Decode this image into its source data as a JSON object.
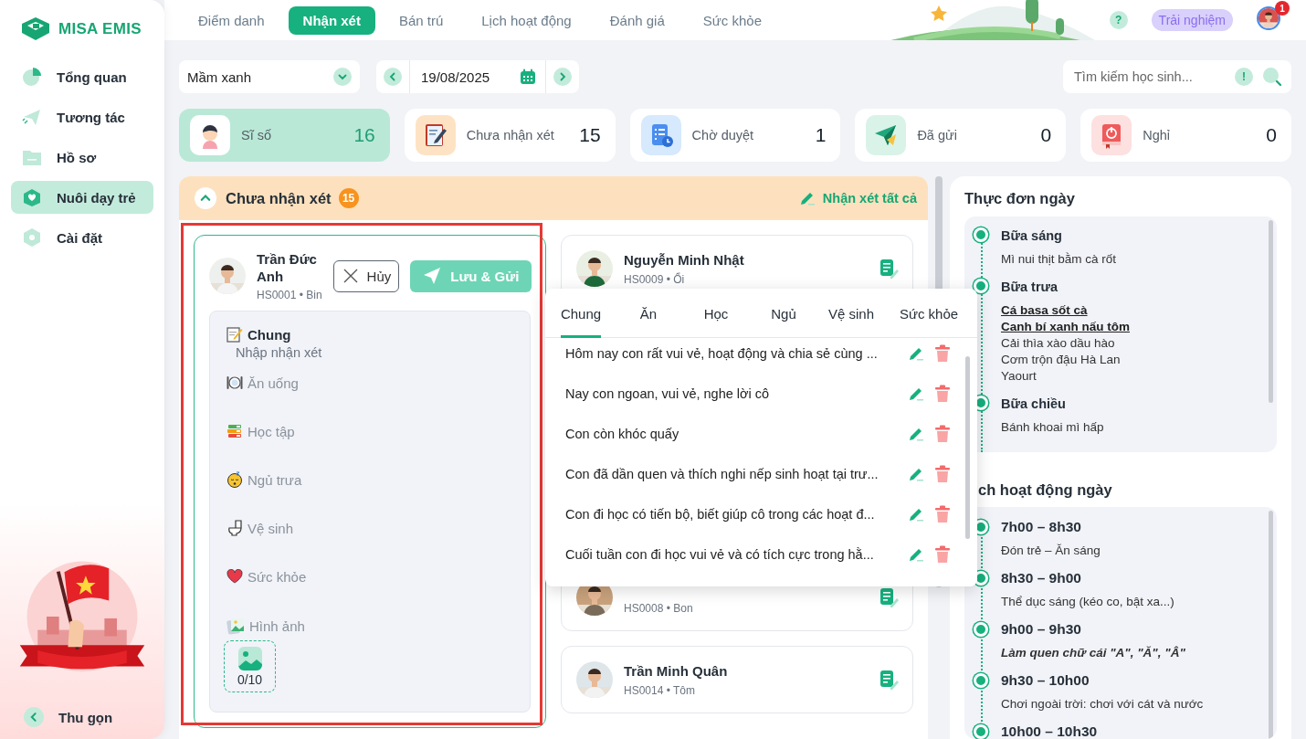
{
  "sidebar": {
    "logo": "MISA EMIS",
    "items": [
      {
        "label": "Tổng quan",
        "selected": false
      },
      {
        "label": "Tương tác",
        "selected": false
      },
      {
        "label": "Hồ sơ",
        "selected": false
      },
      {
        "label": "Nuôi dạy trẻ",
        "selected": true
      },
      {
        "label": "Cài đặt",
        "selected": false
      }
    ],
    "collapse": "Thu gọn"
  },
  "topbar": {
    "tabs": [
      {
        "label": "Điểm danh",
        "selected": false
      },
      {
        "label": "Nhận xét",
        "selected": true
      },
      {
        "label": "Bán trú",
        "selected": false
      },
      {
        "label": "Lịch hoạt động",
        "selected": false
      },
      {
        "label": "Đánh giá",
        "selected": false
      },
      {
        "label": "Sức khỏe",
        "selected": false
      }
    ],
    "help": "?",
    "trial": "Trải nghiệm",
    "notifications": "1"
  },
  "toolbar": {
    "class_select": "Mầm xanh",
    "date": "19/08/2025",
    "search": {
      "placeholder": "Tìm kiếm học sinh..."
    },
    "info": "!"
  },
  "stats": [
    {
      "label": "Sĩ số",
      "value": "16",
      "selected": true,
      "color": "#ffffff"
    },
    {
      "label": "Chưa nhận xét",
      "value": "15",
      "selected": false,
      "color": "#fde3c4"
    },
    {
      "label": "Chờ duyệt",
      "value": "1",
      "selected": false,
      "color": "#d6e9fd"
    },
    {
      "label": "Đã gửi",
      "value": "0",
      "selected": false,
      "color": "#d9f3e8"
    },
    {
      "label": "Nghỉ",
      "value": "0",
      "selected": false,
      "color": "#fde0e0"
    }
  ],
  "review": {
    "title": "Chưa nhận xét",
    "count": "15",
    "expanded": true,
    "action": "Nhận xét tất cả",
    "editor": {
      "name": "Trần Đức Anh",
      "code": "HS0001 • Bin",
      "focused": true,
      "cancel": "Hủy",
      "save": "Lưu & Gửi",
      "sections": [
        {
          "kind": "general",
          "label": "Chung",
          "active": true,
          "placeholder": "Nhập nhận xét"
        },
        {
          "kind": "meal",
          "label": "Ăn uống",
          "active": false
        },
        {
          "kind": "study",
          "label": "Học tập",
          "active": false
        },
        {
          "kind": "sleep",
          "label": "Ngủ trưa",
          "active": false
        },
        {
          "kind": "hygiene",
          "label": "Vệ sinh",
          "active": false
        },
        {
          "kind": "health",
          "label": "Sức khỏe",
          "active": false
        }
      ],
      "photos": {
        "label": "Hình ảnh",
        "count": "0/10"
      }
    },
    "students": [
      {
        "name": "Nguyễn Minh Nhật",
        "code": "HS0009 • Ổi"
      },
      {
        "code": "HS0008 • Bon"
      },
      {
        "name": "Trần Minh Quân",
        "code": "HS0014 • Tôm"
      }
    ]
  },
  "popup": {
    "tabs": [
      {
        "label": "Chung",
        "selected": true
      },
      {
        "label": "Ăn",
        "selected": false
      },
      {
        "label": "Học",
        "selected": false
      },
      {
        "label": "Ngủ",
        "selected": false
      },
      {
        "label": "Vệ sinh",
        "selected": false
      },
      {
        "label": "Sức khỏe",
        "selected": false
      }
    ],
    "comments": [
      "Hôm nay con rất vui vẻ, hoạt động và chia sẻ cùng ...",
      "Nay con ngoan, vui vẻ, nghe lời cô",
      "Con còn khóc quấy",
      "Con đã dần quen và thích nghi nếp sinh hoạt tại trư...",
      "Con đi học có tiến bộ, biết giúp cô trong các hoạt đ...",
      "Cuối tuần con đi học vui vẻ và có tích cực trong hằ..."
    ]
  },
  "menu": {
    "title": "Thực đơn ngày",
    "meals": [
      {
        "name": "Bữa sáng",
        "dishes": [
          {
            "text": "Mì nui thịt bằm cà rốt",
            "highlighted": false
          }
        ]
      },
      {
        "name": "Bữa trưa",
        "dishes": [
          {
            "text": "Cá basa sốt cà",
            "highlighted": true
          },
          {
            "text": "Canh bí xanh nấu tôm",
            "highlighted": true
          },
          {
            "text": "Cải thìa xào dầu hào",
            "highlighted": false
          },
          {
            "text": "Cơm trộn đậu Hà Lan",
            "highlighted": false
          },
          {
            "text": "Yaourt",
            "highlighted": false
          }
        ]
      },
      {
        "name": "Bữa chiều",
        "dishes": [
          {
            "text": "Bánh khoai mì hấp",
            "highlighted": false
          }
        ]
      }
    ]
  },
  "schedule": {
    "title": "ch hoạt động ngày",
    "slots": [
      {
        "time": "7h00 – 8h30",
        "activity": "Đón trẻ – Ăn sáng",
        "highlighted": false
      },
      {
        "time": "8h30 – 9h00",
        "activity": "Thể dục sáng (kéo co, bật xa...)",
        "highlighted": false
      },
      {
        "time": "9h00 – 9h30",
        "activity": "Làm quen chữ cái \"A\", \"Ă\", \"Â\"",
        "highlighted": true
      },
      {
        "time": "9h30 – 10h00",
        "activity": "Chơi ngoài trời: chơi với cát và nước",
        "highlighted": false
      },
      {
        "time": "10h00 – 10h30"
      }
    ]
  }
}
